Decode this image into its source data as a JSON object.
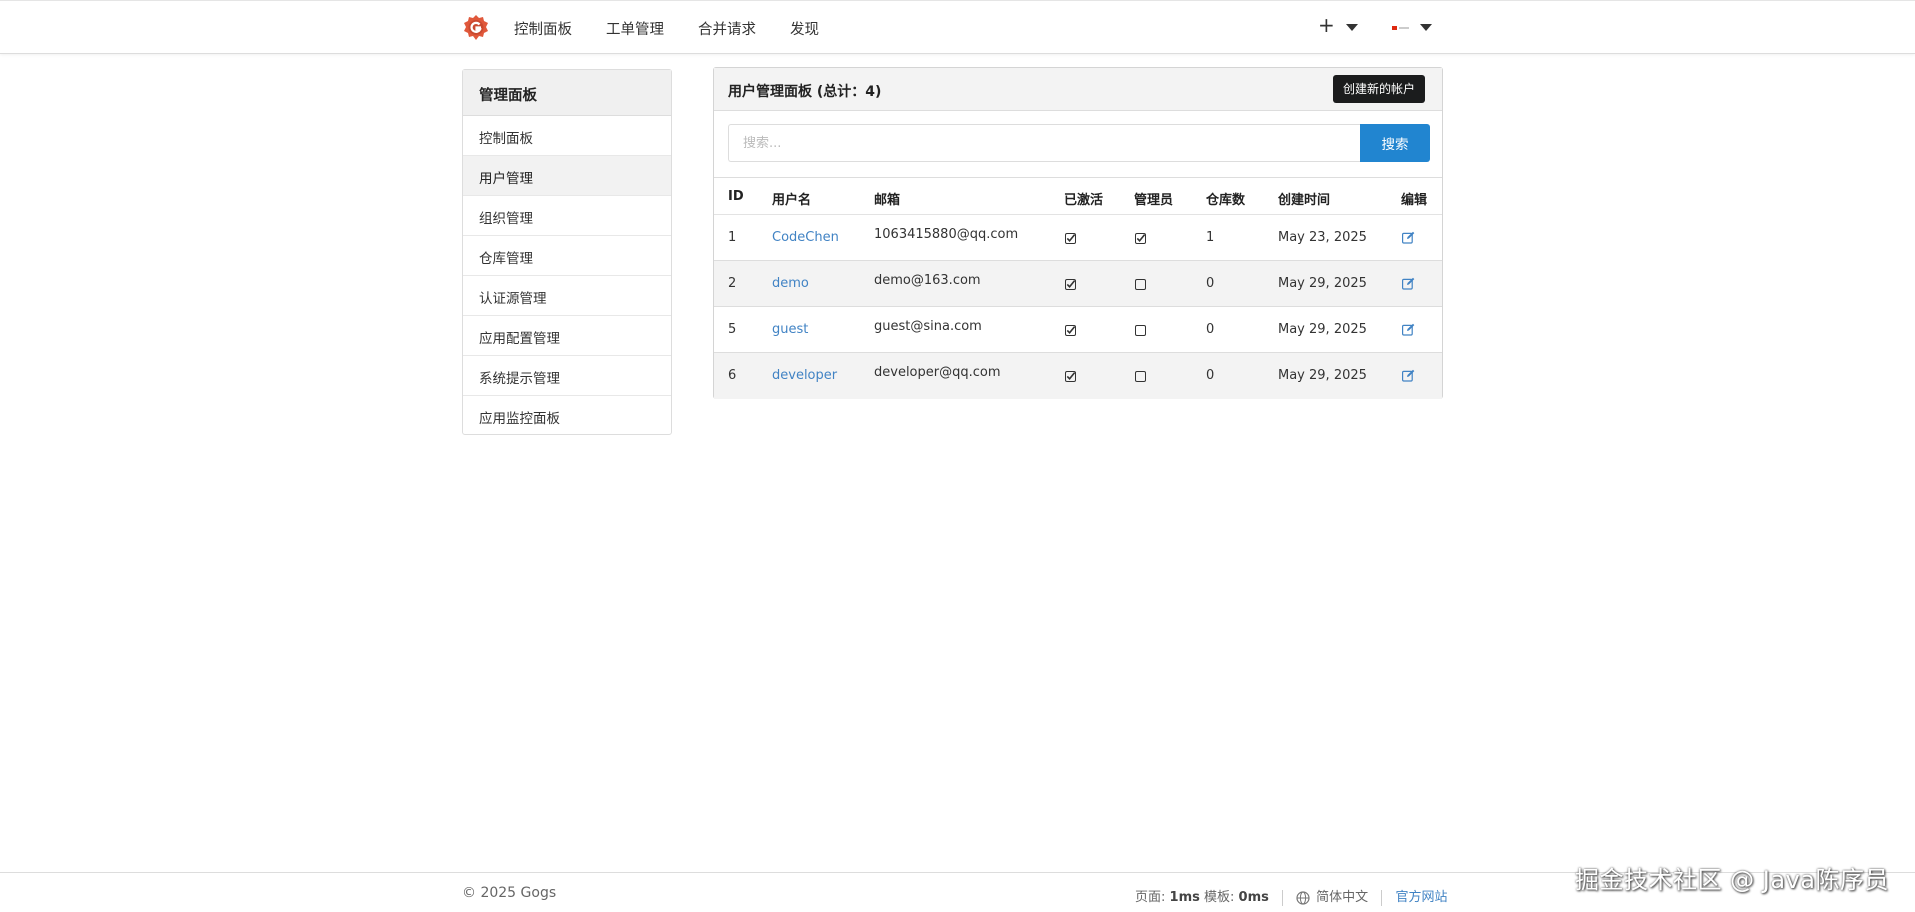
{
  "nav": {
    "items": [
      "控制面板",
      "工单管理",
      "合并请求",
      "发现"
    ],
    "plus": "+"
  },
  "sidebar": {
    "title": "管理面板",
    "items": [
      "控制面板",
      "用户管理",
      "组织管理",
      "仓库管理",
      "认证源管理",
      "应用配置管理",
      "系统提示管理",
      "应用监控面板"
    ],
    "active_index": 1
  },
  "panel": {
    "title": "用户管理面板 (总计：4)",
    "create_button": "创建新的帐户",
    "search_placeholder": "搜索...",
    "search_button": "搜索",
    "columns": [
      "ID",
      "用户名",
      "邮箱",
      "已激活",
      "管理员",
      "仓库数",
      "创建时间",
      "编辑"
    ],
    "rows": [
      {
        "id": "1",
        "username": "CodeChen",
        "email": "1063415880@qq.com",
        "activated": true,
        "admin": true,
        "repos": "1",
        "created": "May 23, 2025"
      },
      {
        "id": "2",
        "username": "demo",
        "email": "demo@163.com",
        "activated": true,
        "admin": false,
        "repos": "0",
        "created": "May 29, 2025"
      },
      {
        "id": "5",
        "username": "guest",
        "email": "guest@sina.com",
        "activated": true,
        "admin": false,
        "repos": "0",
        "created": "May 29, 2025"
      },
      {
        "id": "6",
        "username": "developer",
        "email": "developer@qq.com",
        "activated": true,
        "admin": false,
        "repos": "0",
        "created": "May 29, 2025"
      }
    ]
  },
  "footer": {
    "copyright": "© 2025 Gogs",
    "page_label": "页面:",
    "page_time": "1ms",
    "template_label": "模板:",
    "template_time": "0ms",
    "language": "简体中文",
    "official_site": "官方网站"
  },
  "watermark": "掘金技术社区 @ Java陈序员",
  "colors": {
    "primary": "#2185d0",
    "link": "#4183c4",
    "dark_button": "#1b1c1d",
    "logo": "#e0583b"
  }
}
